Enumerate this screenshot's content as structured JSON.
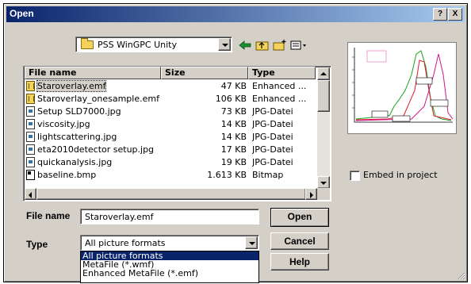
{
  "window": {
    "title": "Open",
    "help_btn": "?",
    "close_btn": "X"
  },
  "lookin": {
    "value": "PSS WinGPC Unity"
  },
  "columns": {
    "name": "File name",
    "size": "Size",
    "type": "Type"
  },
  "files": [
    {
      "name": "Staroverlay.emf",
      "size": "47 KB",
      "type": "Enhanced ...",
      "icon": "emf",
      "selected": true
    },
    {
      "name": "Staroverlay_onesample.emf",
      "size": "106 KB",
      "type": "Enhanced ...",
      "icon": "emf"
    },
    {
      "name": "Setup SLD7000.jpg",
      "size": "73 KB",
      "type": "JPG-Datei",
      "icon": "jpg"
    },
    {
      "name": "viscosity.jpg",
      "size": "14 KB",
      "type": "JPG-Datei",
      "icon": "jpg"
    },
    {
      "name": "lightscattering.jpg",
      "size": "14 KB",
      "type": "JPG-Datei",
      "icon": "jpg"
    },
    {
      "name": "eta2010detector setup.jpg",
      "size": "17 KB",
      "type": "JPG-Datei",
      "icon": "jpg"
    },
    {
      "name": "quickanalysis.jpg",
      "size": "19 KB",
      "type": "JPG-Datei",
      "icon": "jpg"
    },
    {
      "name": "baseline.bmp",
      "size": "1.613 KB",
      "type": "Bitmap",
      "icon": "bmp"
    }
  ],
  "form": {
    "filename_label": "File name",
    "filename_value": "Staroverlay.emf",
    "type_label": "Type",
    "type_value": "All picture formats"
  },
  "type_options": [
    "All picture formats",
    "MetaFile (*.wmf)",
    "Enhanced MetaFile (*.emf)"
  ],
  "buttons": {
    "open": "Open",
    "cancel": "Cancel",
    "help": "Help"
  },
  "embed": {
    "label": "Embed in project",
    "checked": false
  },
  "colors": {
    "title_start": "#0a246a",
    "title_end": "#a6caf0",
    "selection": "#0a246a",
    "face": "#d4d0c8"
  }
}
